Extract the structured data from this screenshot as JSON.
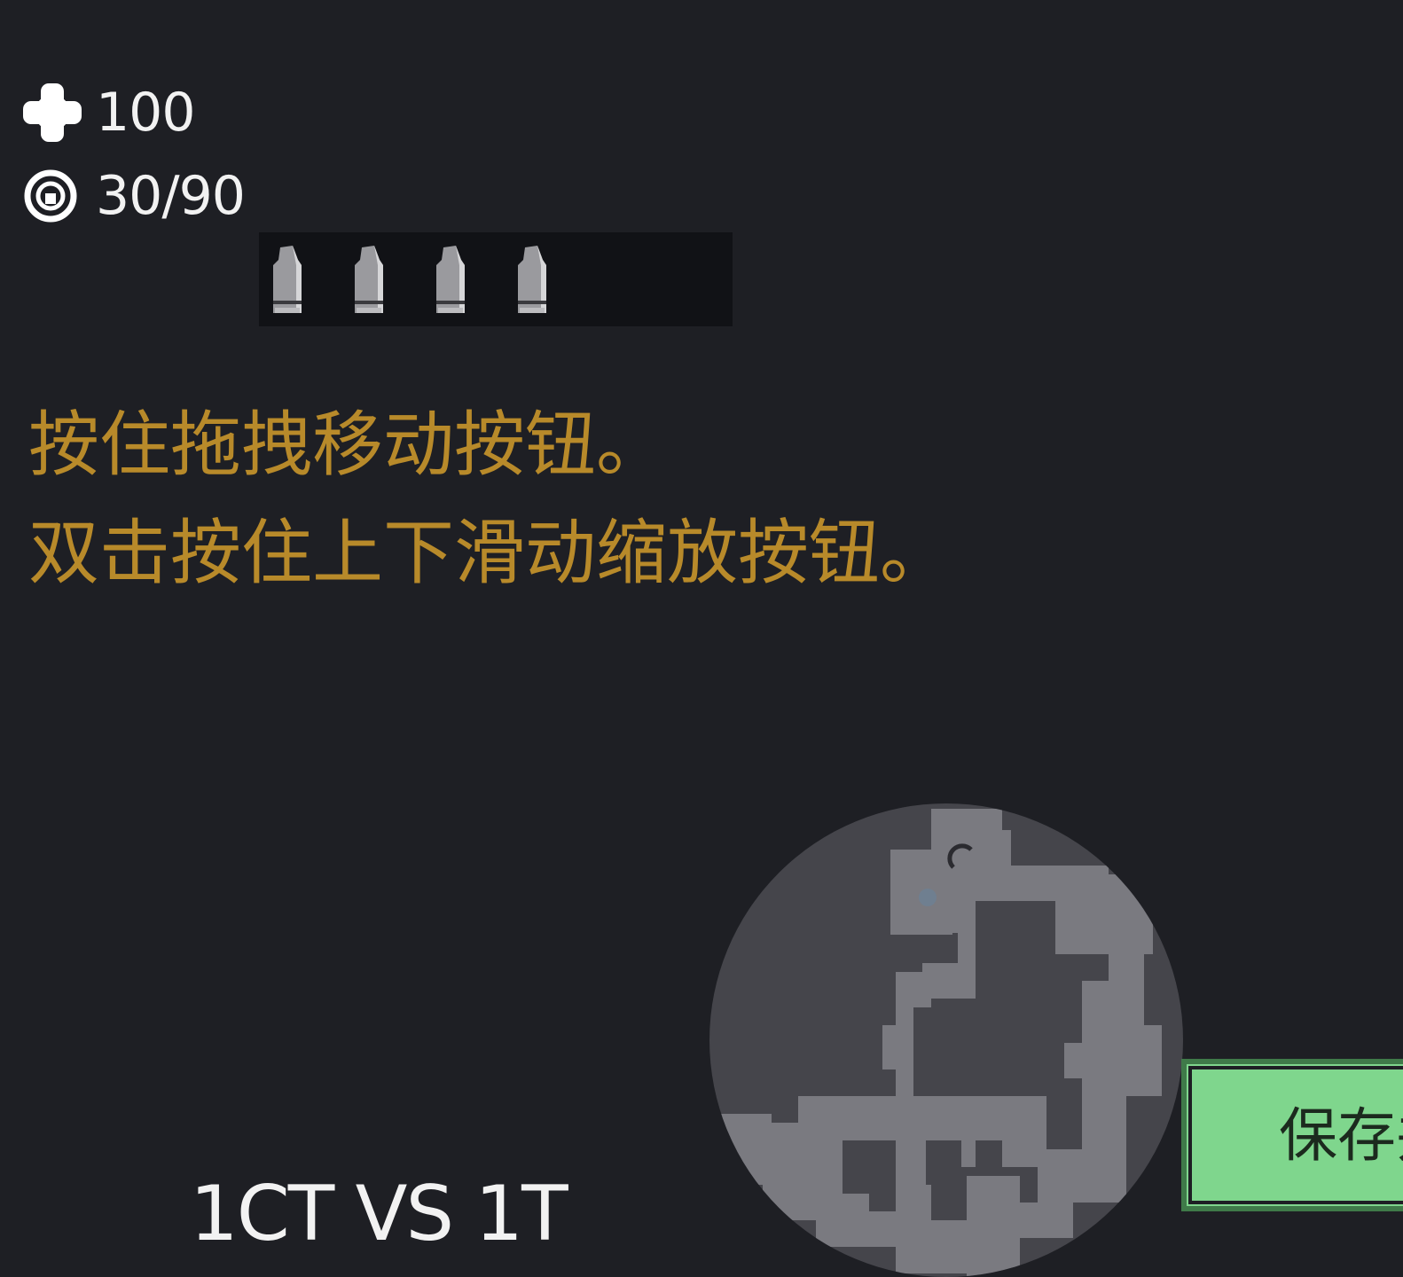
{
  "hud": {
    "health": {
      "icon": "health-cross-icon",
      "value": "100"
    },
    "ammo": {
      "icon": "ammo-ring-icon",
      "value": "30/90"
    },
    "grenades": {
      "icon": "grenade-icon",
      "count": 4
    }
  },
  "hints": {
    "line1": "按住拖拽移动按钮。",
    "line2": "双击按住上下滑动缩放按钮。"
  },
  "match": {
    "label": "1CT VS 1T"
  },
  "minimap": {
    "icon": "minimap"
  },
  "actions": {
    "save_label": "保存并"
  },
  "colors": {
    "background": "#1e1f24",
    "hint_text": "#b88a2a",
    "hud_text": "#f2f2f2",
    "save_button": "#7fd68d",
    "grenade_panel": "#111216",
    "map_background": "#45454b",
    "map_floor": "#7a7a80"
  }
}
